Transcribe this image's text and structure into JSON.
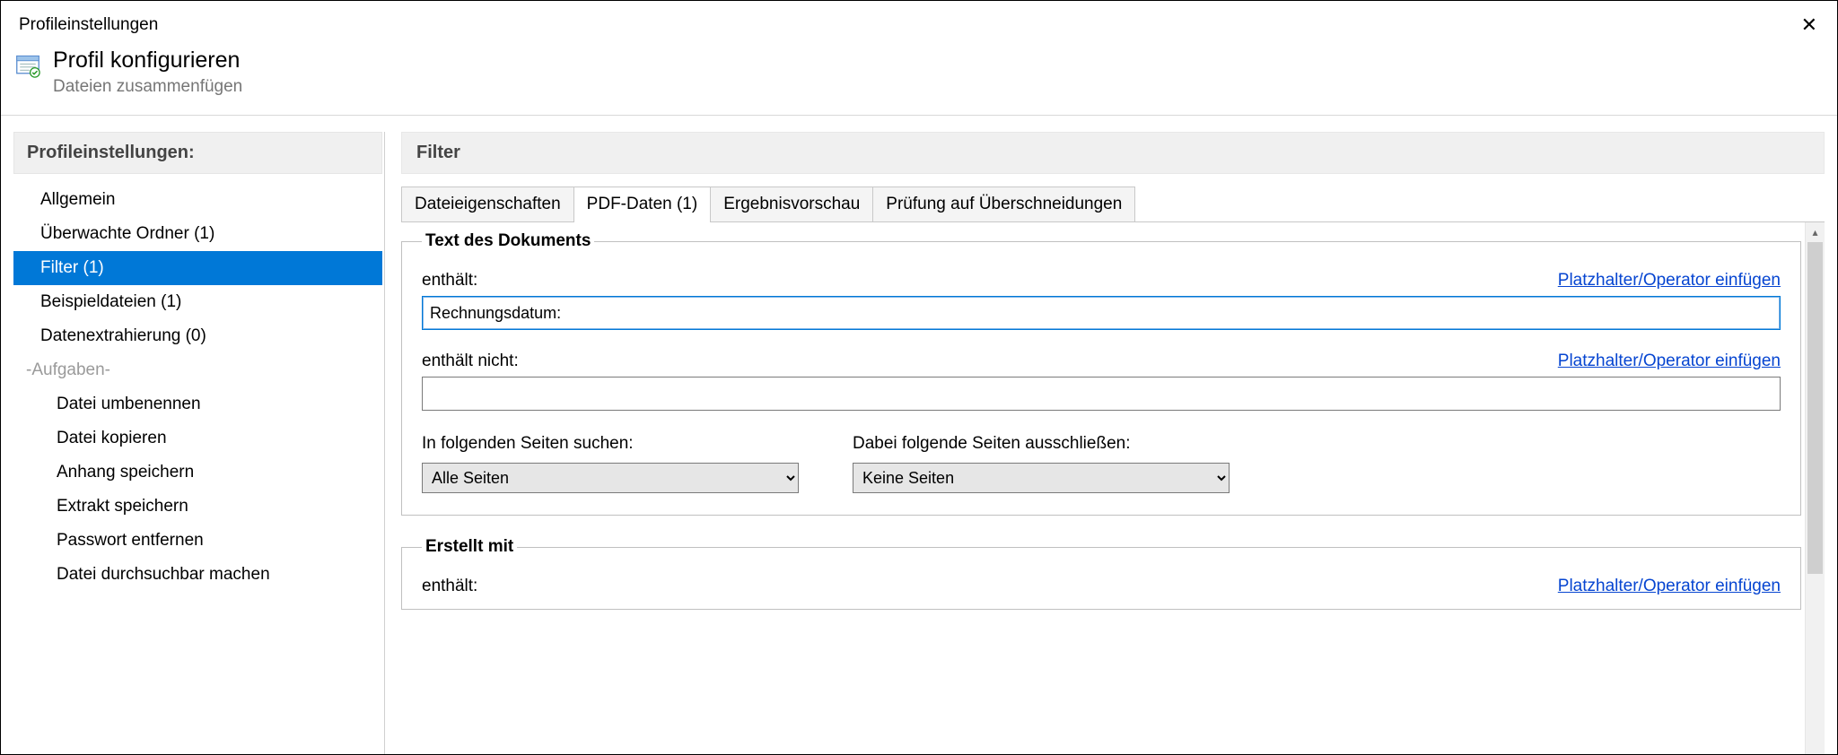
{
  "window": {
    "title": "Profileinstellungen"
  },
  "header": {
    "title": "Profil konfigurieren",
    "subtitle": "Dateien zusammenfügen"
  },
  "sidebar": {
    "heading": "Profileinstellungen:",
    "items": [
      {
        "label": "Allgemein",
        "kind": "item"
      },
      {
        "label": "Überwachte Ordner (1)",
        "kind": "item"
      },
      {
        "label": "Filter (1)",
        "kind": "item",
        "selected": true
      },
      {
        "label": "Beispieldateien (1)",
        "kind": "item"
      },
      {
        "label": "Datenextrahierung (0)",
        "kind": "item"
      },
      {
        "label": "-Aufgaben-",
        "kind": "group"
      },
      {
        "label": "Datei umbenennen",
        "kind": "child"
      },
      {
        "label": "Datei kopieren",
        "kind": "child"
      },
      {
        "label": "Anhang speichern",
        "kind": "child"
      },
      {
        "label": "Extrakt speichern",
        "kind": "child"
      },
      {
        "label": "Passwort entfernen",
        "kind": "child"
      },
      {
        "label": "Datei durchsuchbar machen",
        "kind": "child"
      }
    ]
  },
  "main": {
    "heading": "Filter",
    "tabs": [
      {
        "label": "Dateieigenschaften"
      },
      {
        "label": "PDF-Daten (1)",
        "active": true
      },
      {
        "label": "Ergebnisvorschau"
      },
      {
        "label": "Prüfung auf Überschneidungen"
      }
    ],
    "group1": {
      "legend": "Text des Dokuments",
      "contains_label": "enthält:",
      "contains_value": "Rechnungsdatum:",
      "not_contains_label": "enthält nicht:",
      "not_contains_value": "",
      "insert_link": "Platzhalter/Operator einfügen",
      "search_pages_label": "In folgenden Seiten suchen:",
      "search_pages_value": "Alle Seiten",
      "exclude_pages_label": "Dabei folgende Seiten ausschließen:",
      "exclude_pages_value": "Keine Seiten"
    },
    "group2": {
      "legend": "Erstellt mit",
      "contains_label": "enthält:",
      "insert_link": "Platzhalter/Operator einfügen"
    }
  }
}
